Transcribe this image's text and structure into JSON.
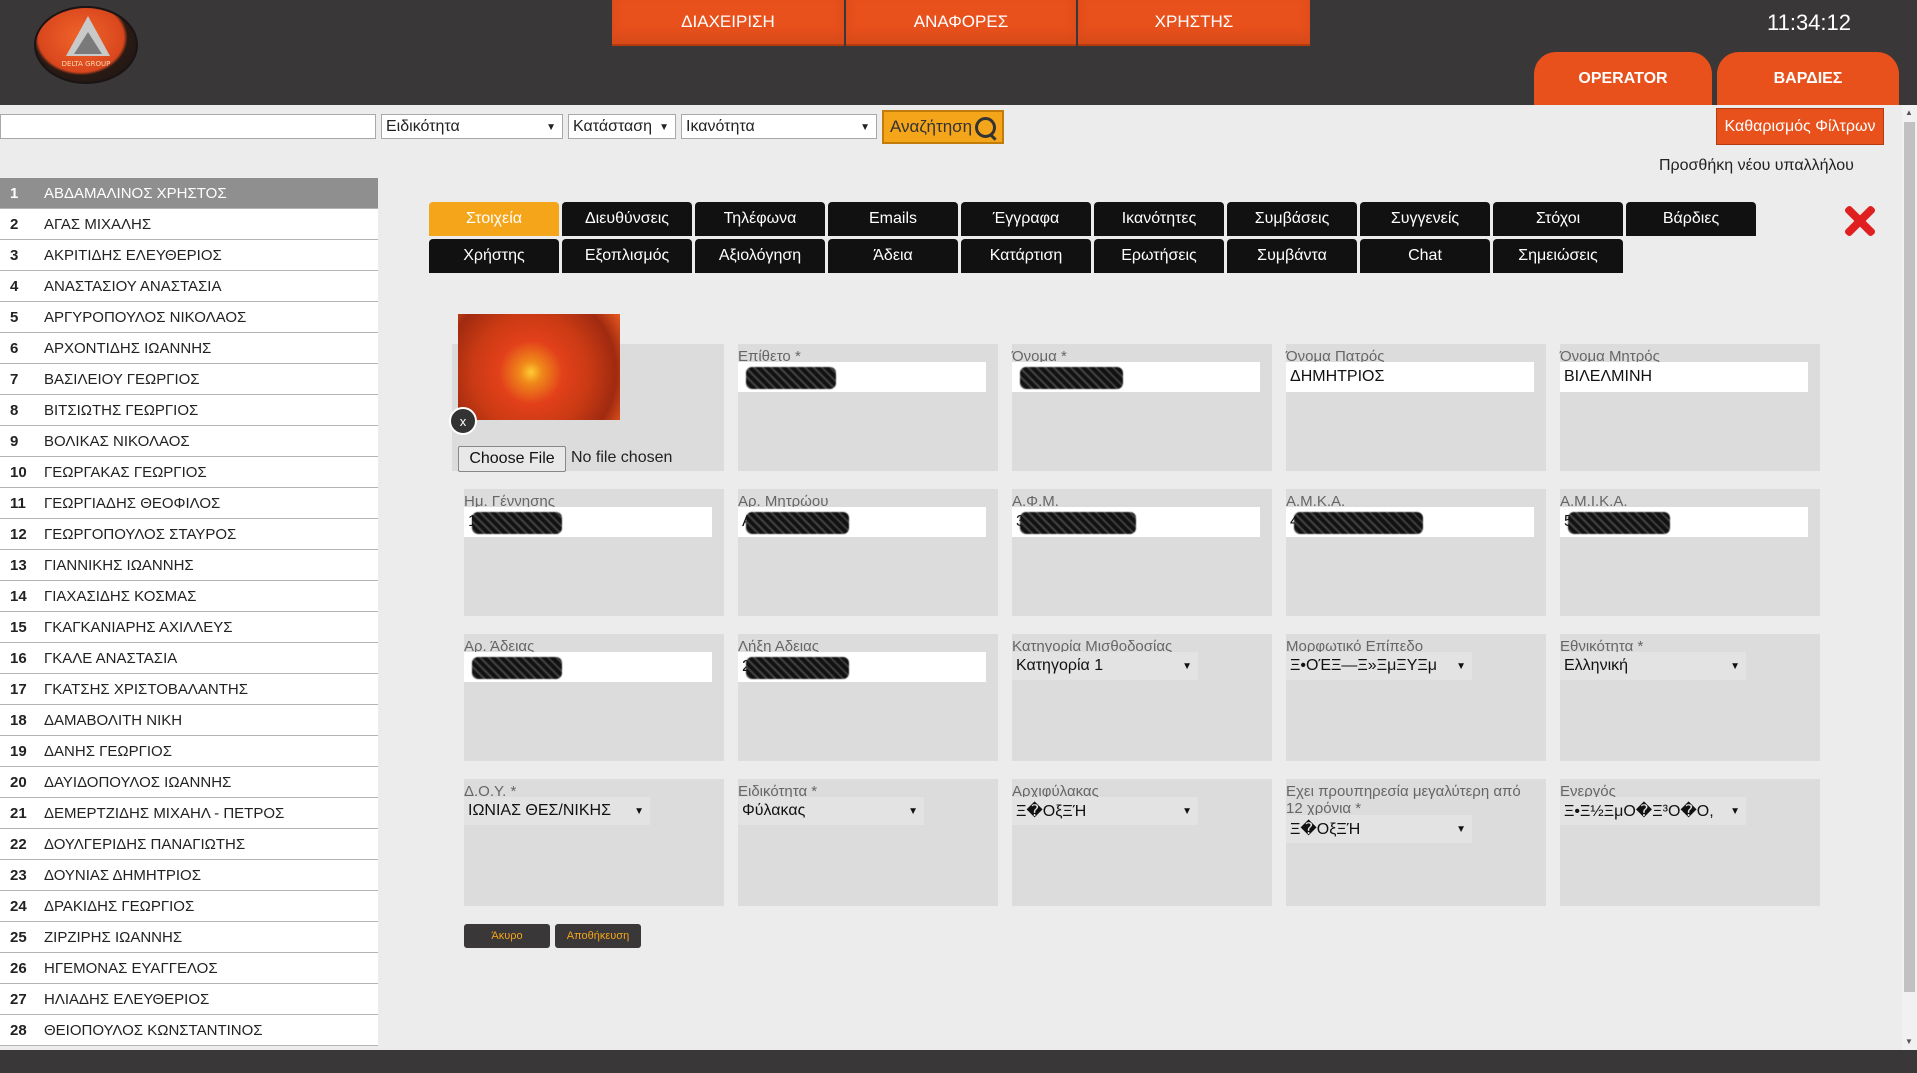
{
  "header": {
    "logo_text": "DELTA GROUP",
    "nav": [
      "ΔΙΑΧΕΙΡΙΣΗ",
      "ΑΝΑΦΟΡΕΣ",
      "ΧΡΗΣΤΗΣ"
    ],
    "clock": "11:34:12",
    "side_tabs": [
      "OPERATOR",
      "ΒΑΡΔΙΕΣ"
    ]
  },
  "filters": {
    "search_value": "",
    "specialty": "Ειδικότητα",
    "status": "Κατάσταση",
    "ability": "Ικανότητα",
    "search_button": "Αναζήτηση",
    "clear_button": "Καθαρισμός Φίλτρων",
    "add_employee": "Προσθήκη νέου υπαλλήλου"
  },
  "employees": [
    {
      "n": "1",
      "name": "ΑΒΔΑΜΑΛΙΝΟΣ ΧΡΗΣΤΟΣ"
    },
    {
      "n": "2",
      "name": "ΑΓΑΣ ΜΙΧΑΛΗΣ"
    },
    {
      "n": "3",
      "name": "ΑΚΡΙΤΙΔΗΣ ΕΛΕΥΘΕΡΙΟΣ"
    },
    {
      "n": "4",
      "name": "ΑΝΑΣΤΑΣΙΟΥ ΑΝΑΣΤΑΣΙΑ"
    },
    {
      "n": "5",
      "name": "ΑΡΓΥΡΟΠΟΥΛΟΣ ΝΙΚΟΛΑΟΣ"
    },
    {
      "n": "6",
      "name": "ΑΡΧΟΝΤΙΔΗΣ ΙΩΑΝΝΗΣ"
    },
    {
      "n": "7",
      "name": "ΒΑΣΙΛΕΙΟΥ ΓΕΩΡΓΙΟΣ"
    },
    {
      "n": "8",
      "name": "ΒΙΤΣΙΩΤΗΣ ΓΕΩΡΓΙΟΣ"
    },
    {
      "n": "9",
      "name": "ΒΟΛΙΚΑΣ ΝΙΚΟΛΑΟΣ"
    },
    {
      "n": "10",
      "name": "ΓΕΩΡΓΑΚΑΣ ΓΕΩΡΓΙΟΣ"
    },
    {
      "n": "11",
      "name": "ΓΕΩΡΓΙΑΔΗΣ ΘΕΟΦΙΛΟΣ"
    },
    {
      "n": "12",
      "name": "ΓΕΩΡΓΟΠΟΥΛΟΣ ΣΤΑΥΡΟΣ"
    },
    {
      "n": "13",
      "name": "ΓΙΑΝΝΙΚΗΣ ΙΩΑΝΝΗΣ"
    },
    {
      "n": "14",
      "name": "ΓΙΑΧΑΣΙΔΗΣ ΚΟΣΜΑΣ"
    },
    {
      "n": "15",
      "name": "ΓΚΑΓΚΑΝΙΑΡΗΣ ΑΧΙΛΛΕΥΣ"
    },
    {
      "n": "16",
      "name": "ΓΚΑΛΕ ΑΝΑΣΤΑΣΙΑ"
    },
    {
      "n": "17",
      "name": "ΓΚΑΤΣΗΣ ΧΡΙΣΤΟΒΑΛΑΝΤΗΣ"
    },
    {
      "n": "18",
      "name": "ΔΑΜΑΒΟΛΙΤΗ ΝΙΚΗ"
    },
    {
      "n": "19",
      "name": "ΔΑΝΗΣ ΓΕΩΡΓΙΟΣ"
    },
    {
      "n": "20",
      "name": "ΔΑΥΙΔΟΠΟΥΛΟΣ ΙΩΑΝΝΗΣ"
    },
    {
      "n": "21",
      "name": "ΔΕΜΕΡΤΖΙΔΗΣ ΜΙΧΑΗΛ - ΠΕΤΡΟΣ"
    },
    {
      "n": "22",
      "name": "ΔΟΥΛΓΕΡΙΔΗΣ ΠΑΝΑΓΙΩΤΗΣ"
    },
    {
      "n": "23",
      "name": "ΔΟΥΝΙΑΣ ΔΗΜΗΤΡΙΟΣ"
    },
    {
      "n": "24",
      "name": "ΔΡΑΚΙΔΗΣ ΓΕΩΡΓΙΟΣ"
    },
    {
      "n": "25",
      "name": "ΖΙΡΖΙΡΗΣ ΙΩΑΝΝΗΣ"
    },
    {
      "n": "26",
      "name": "ΗΓΕΜΟΝΑΣ ΕΥΑΓΓΕΛΟΣ"
    },
    {
      "n": "27",
      "name": "ΗΛΙΑΔΗΣ ΕΛΕΥΘΕΡΙΟΣ"
    },
    {
      "n": "28",
      "name": "ΘΕΙΟΠΟΥΛΟΣ ΚΩΝΣΤΑΝΤΙΝΟΣ"
    }
  ],
  "tabs_row1": [
    "Στοιχεία",
    "Διευθύνσεις",
    "Τηλέφωνα",
    "Emails",
    "Έγγραφα",
    "Ικανότητες",
    "Συμβάσεις",
    "Συγγενείς",
    "Στόχοι",
    "Βάρδιες"
  ],
  "tabs_row2": [
    "Χρήστης",
    "Εξοπλισμός",
    "Αξιολόγηση",
    "Άδεια",
    "Κατάρτιση",
    "Ερωτήσεις",
    "Συμβάντα",
    "Chat",
    "Σημειώσεις"
  ],
  "photo": {
    "remove": "x",
    "choose_file": "Choose File",
    "file_status": "No file chosen"
  },
  "form": {
    "row1": [
      {
        "label": "Επίθετο *",
        "value": "",
        "redacted": true
      },
      {
        "label": "Όνομα *",
        "value": "",
        "redacted": true
      },
      {
        "label": "Όνομα Πατρός",
        "value": "ΔΗΜΗΤΡΙΟΣ"
      },
      {
        "label": "Όνομα Μητρός",
        "value": "ΒΙΛΕΛΜΙΝΗ"
      }
    ],
    "row2": [
      {
        "label": "Ημ. Γέννησης",
        "value": "1",
        "redacted": true
      },
      {
        "label": "Αρ. Μητρώου",
        "value": "A",
        "redacted": true
      },
      {
        "label": "Α.Φ.Μ.",
        "value": "3",
        "redacted": true
      },
      {
        "label": "Α.Μ.Κ.Α.",
        "value": "4",
        "redacted": true
      },
      {
        "label": "Α.Μ.Ι.Κ.Α.",
        "value": "5",
        "redacted": true
      }
    ],
    "row3": [
      {
        "label": "Αρ. Άδειας",
        "value": "",
        "redacted": true
      },
      {
        "label": "Λήξη Αδειας",
        "value": "2",
        "redacted": true
      },
      {
        "label": "Κατηγορία Μισθοδοσίας",
        "select": "Κατηγορία 1"
      },
      {
        "label": "Μορφωτικό Επίπεδο",
        "select": "Ξ•ΟΈΞ—Ξ»ΞμΞΥΞμ"
      },
      {
        "label": "Εθνικότητα *",
        "select": "Ελληνική"
      }
    ],
    "row4": [
      {
        "label": "Δ.Ο.Υ. *",
        "select": "ΙΩΝΙΑΣ ΘΕΣ/ΝΙΚΗΣ"
      },
      {
        "label": "Ειδικότητα *",
        "select": "Φύλακας"
      },
      {
        "label": "Αρχιφύλακας",
        "select": "Ξ�ΟξΞΉ"
      },
      {
        "label": "Εχει προυπηρεσία μεγαλύτερη από 12 χρόνια *",
        "select": "Ξ�ΟξΞΉ"
      },
      {
        "label": "Ενεργός",
        "select": "Ξ•Ξ½ΞμΟ�Ξ³Ο�Ο,"
      }
    ]
  },
  "actions": {
    "cancel": "Άκυρο",
    "save": "Αποθήκευση"
  },
  "colors": {
    "accent": "#e8501c",
    "active_tab": "#f4a51a",
    "header": "#3a3738"
  }
}
